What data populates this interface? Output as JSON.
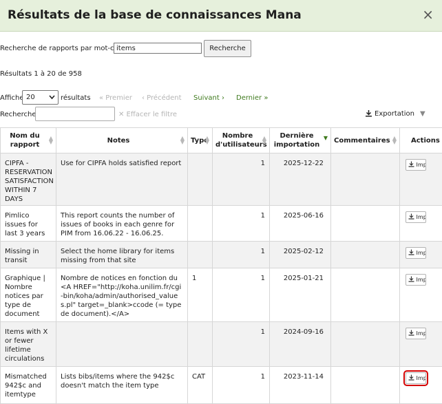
{
  "modal": {
    "title": "Résultats de la base de connaissances Mana",
    "close_glyph": "×"
  },
  "keyword_search": {
    "label": "Recherche de rapports par mot-clé :",
    "value": "items",
    "button": "Recherche"
  },
  "results_info": "Résultats 1 à 20 de 958",
  "length_menu": {
    "label": "Afficher",
    "value": "20",
    "suffix": "résultats"
  },
  "pagination": {
    "first": "« Premier",
    "previous": "‹ Précédent",
    "next": "Suivant ›",
    "last": "Dernier »"
  },
  "filter": {
    "label": "Rechercher :",
    "value": "",
    "clear": "✕ Effacer le filtre"
  },
  "export": {
    "label": "Exportation"
  },
  "table": {
    "columns": {
      "name": "Nom du rapport",
      "notes": "Notes",
      "type": "Type",
      "users": "Nombre d'utilisateurs",
      "last_import": "Dernière importation",
      "comments": "Commentaires",
      "actions": "Actions"
    },
    "import_label": "Importer",
    "rows": [
      {
        "name": "CIPFA - RESERVATION SATISFACTION WITHIN 7 DAYS",
        "notes": "Use for CIPFA holds satisfied report",
        "type": "",
        "users": "1",
        "last_import": "2025-12-22",
        "comments": ""
      },
      {
        "name": "Pimlico issues for last 3 years",
        "notes": "This report counts the number of issues of books in each genre for PIM from 16.06.22 - 16.06.25.",
        "type": "",
        "users": "1",
        "last_import": "2025-06-16",
        "comments": ""
      },
      {
        "name": "Missing in transit",
        "notes": "Select the home library for items missing from that site",
        "type": "",
        "users": "1",
        "last_import": "2025-02-12",
        "comments": ""
      },
      {
        "name": "Graphique | Nombre notices par type de document",
        "notes": "Nombre de notices en fonction du <A HREF=\"http://koha.unilim.fr/cgi-bin/koha/admin/authorised_values.pl\" target=_blank>ccode (= type de document).</A>",
        "type": "1",
        "users": "1",
        "last_import": "2025-01-21",
        "comments": ""
      },
      {
        "name": "Items with X or fewer lifetime circulations",
        "notes": "",
        "type": "",
        "users": "1",
        "last_import": "2024-09-16",
        "comments": ""
      },
      {
        "name": "Mismatched 942$c and itemtype",
        "notes": "Lists bibs/items where the 942$c doesn't match the item type",
        "type": "CAT",
        "users": "1",
        "last_import": "2023-11-14",
        "comments": ""
      }
    ]
  },
  "colors": {
    "header_bg": "#e6f0dc",
    "link_green": "#3f7a1e",
    "focus_outline": "#d40000"
  }
}
